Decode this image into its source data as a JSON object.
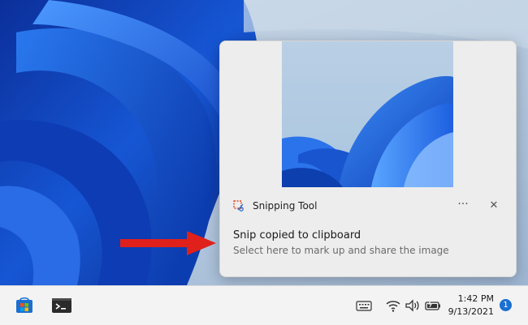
{
  "notification": {
    "app_name": "Snipping Tool",
    "more_label": "···",
    "close_label": "✕",
    "title": "Snip copied to clipboard",
    "body": "Select here to mark up and share the image"
  },
  "taskbar": {
    "time": "1:42 PM",
    "date": "9/13/2021",
    "badge_count": "1",
    "icons": [
      "store-icon",
      "terminal-icon",
      "keyboard-icon",
      "wifi-icon",
      "speaker-icon",
      "battery-icon"
    ]
  },
  "colors": {
    "accent": "#1a6fd1",
    "arrow": "#e0201a",
    "wallpaper_blue": "#1b5fd8"
  }
}
